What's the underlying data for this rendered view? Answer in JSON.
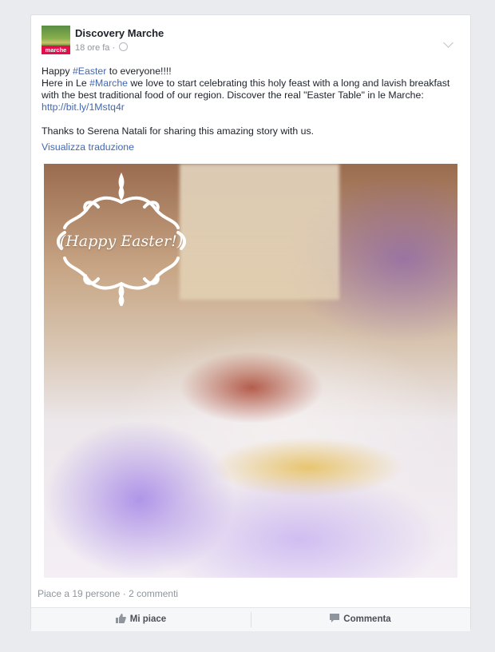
{
  "post": {
    "page_name": "Discovery Marche",
    "avatar_label": "marche",
    "timestamp": "18 ore fa ·",
    "text": {
      "line1_pre": "Happy ",
      "line1_tag": "#Easter",
      "line1_post": " to everyone!!!!",
      "line2_pre": "Here in Le ",
      "line2_tag": "#Marche",
      "line2_post": " we love to start celebrating this holy feast with a long and lavish breakfast with the best traditional food of our region. Discover the real \"Easter Table\" in le Marche:",
      "link": "http://bit.ly/1Mstq4r",
      "thanks": "Thanks to Serena Natali for sharing this amazing story with us."
    },
    "translate_label": "Visualizza traduzione",
    "image_overlay_text": "(Happy Easter!)",
    "stats": "Piace a 19 persone · 2 commenti"
  },
  "actions": {
    "like_label": "Mi piace",
    "comment_label": "Commenta"
  },
  "colors": {
    "link": "#4267b2",
    "brand_ribbon": "#e20f4d",
    "muted": "#90949c"
  },
  "icons": {
    "like": "thumbs-up-icon",
    "comment": "speech-bubble-icon",
    "audience": "globe-icon",
    "menu": "chevron-down-icon"
  }
}
